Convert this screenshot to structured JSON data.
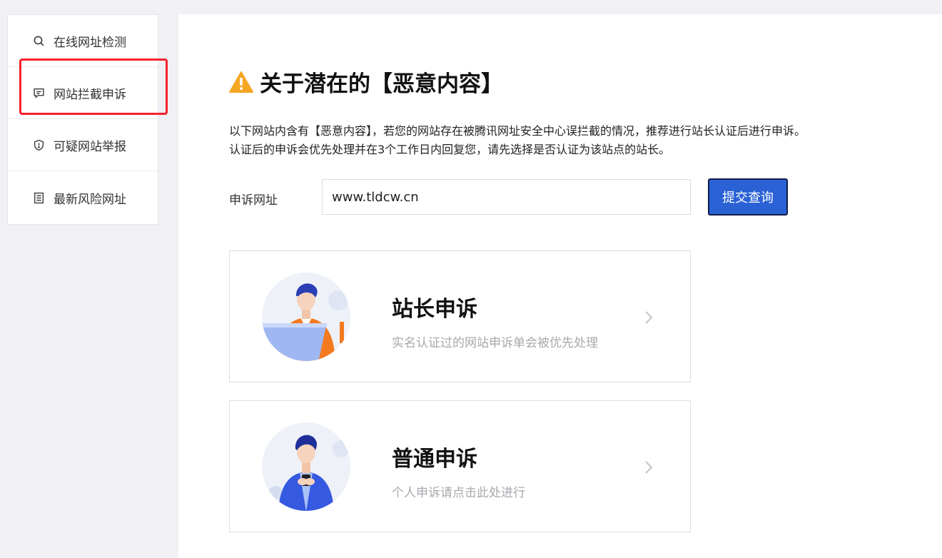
{
  "sidebar": {
    "items": [
      {
        "label": "在线网址检测",
        "icon": "search-icon"
      },
      {
        "label": "网站拦截申诉",
        "icon": "comment-icon"
      },
      {
        "label": "可疑网站举报",
        "icon": "shield-icon"
      },
      {
        "label": "最新风险网址",
        "icon": "document-list-icon"
      }
    ]
  },
  "main": {
    "title": "关于潜在的【恶意内容】",
    "description_line1": "以下网站内含有【恶意内容】，若您的网站存在被腾讯网址安全中心误拦截的情况，推荐进行站长认证后进行申诉。",
    "description_line2": "认证后的申诉会优先处理并在3个工作日内回复您，请先选择是否认证为该站点的站长。",
    "url_label": "申诉网址",
    "url_value": "www.tldcw.cn",
    "submit_label": "提交查询",
    "cards": [
      {
        "title": "站长申诉",
        "subtitle": "实名认证过的网站申诉单会被优先处理"
      },
      {
        "title": "普通申诉",
        "subtitle": "个人申诉请点击此处进行"
      }
    ]
  },
  "colors": {
    "accent": "#2a62d6",
    "warning": "#f5a623",
    "highlight": "#f5222d"
  }
}
